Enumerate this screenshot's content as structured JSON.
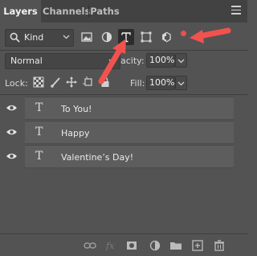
{
  "tabs": [
    {
      "label": "Layers",
      "active": true
    },
    {
      "label": "Channels",
      "active": false
    },
    {
      "label": "Paths",
      "active": false
    }
  ],
  "filter": {
    "kind_label": "Kind",
    "icons": [
      "pixel-filter-icon",
      "adjustment-filter-icon",
      "type-filter-icon",
      "shape-filter-icon",
      "smart-object-filter-icon"
    ],
    "selected_icon": "type-filter-icon",
    "toggle_color": "#e8524a"
  },
  "blend_mode": "Normal",
  "opacity_label": "Opacity:",
  "opacity_visible_label": "acity:",
  "opacity_value": "100%",
  "lock_label": "Lock:",
  "lock_icons": [
    "lock-transparent-pixels-icon",
    "lock-image-pixels-icon",
    "lock-position-icon",
    "lock-artboard-icon",
    "lock-all-icon"
  ],
  "fill_label": "Fill:",
  "fill_value": "100%",
  "layers": [
    {
      "name": "To You!",
      "type_icon": "T",
      "visible": true
    },
    {
      "name": "Happy",
      "type_icon": "T",
      "visible": true
    },
    {
      "name": "Valentine’s Day!",
      "type_icon": "T",
      "visible": true
    }
  ],
  "footer_icons": [
    "link-layers-icon",
    "fx-icon",
    "add-mask-icon",
    "adjustment-layer-icon",
    "new-group-icon",
    "new-layer-icon",
    "trash-icon"
  ],
  "colors": {
    "panel_bg": "#535353",
    "tab_bar_bg": "#424242",
    "layer_bg": "#5d5d5d",
    "annotation_arrow": "#f2524e"
  }
}
